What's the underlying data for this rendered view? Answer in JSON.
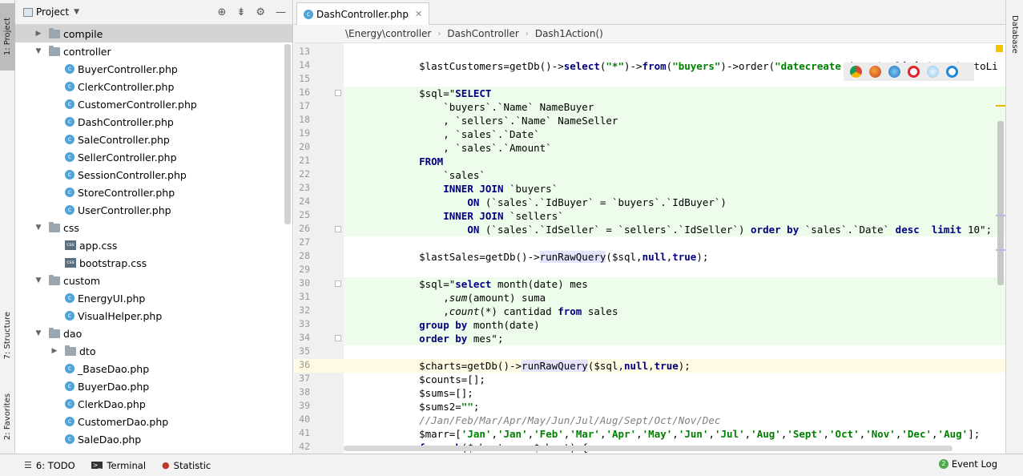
{
  "left_strip": {
    "project_tab": "1: Project",
    "structure_tab": "7: Structure",
    "favorites_tab": "2: Favorites"
  },
  "project_panel": {
    "title": "Project",
    "tree": [
      {
        "label": "compile",
        "type": "folder",
        "depth": 1,
        "expanded": false,
        "selected": true
      },
      {
        "label": "controller",
        "type": "folder",
        "depth": 1,
        "expanded": true
      },
      {
        "label": "BuyerController.php",
        "type": "php",
        "depth": 2
      },
      {
        "label": "ClerkController.php",
        "type": "php",
        "depth": 2
      },
      {
        "label": "CustomerController.php",
        "type": "php",
        "depth": 2
      },
      {
        "label": "DashController.php",
        "type": "php",
        "depth": 2
      },
      {
        "label": "SaleController.php",
        "type": "php",
        "depth": 2
      },
      {
        "label": "SellerController.php",
        "type": "php",
        "depth": 2
      },
      {
        "label": "SessionController.php",
        "type": "php",
        "depth": 2
      },
      {
        "label": "StoreController.php",
        "type": "php",
        "depth": 2
      },
      {
        "label": "UserController.php",
        "type": "php",
        "depth": 2
      },
      {
        "label": "css",
        "type": "folder",
        "depth": 1,
        "expanded": true
      },
      {
        "label": "app.css",
        "type": "css",
        "depth": 2
      },
      {
        "label": "bootstrap.css",
        "type": "css",
        "depth": 2
      },
      {
        "label": "custom",
        "type": "folder",
        "depth": 1,
        "expanded": true
      },
      {
        "label": "EnergyUI.php",
        "type": "php",
        "depth": 2
      },
      {
        "label": "VisualHelper.php",
        "type": "php",
        "depth": 2
      },
      {
        "label": "dao",
        "type": "folder",
        "depth": 1,
        "expanded": true
      },
      {
        "label": "dto",
        "type": "folder",
        "depth": 2,
        "expanded": false
      },
      {
        "label": "_BaseDao.php",
        "type": "php",
        "depth": 2
      },
      {
        "label": "BuyerDao.php",
        "type": "php",
        "depth": 2
      },
      {
        "label": "ClerkDao.php",
        "type": "php",
        "depth": 2
      },
      {
        "label": "CustomerDao.php",
        "type": "php",
        "depth": 2
      },
      {
        "label": "SaleDao.php",
        "type": "php",
        "depth": 2
      }
    ]
  },
  "editor": {
    "tab_label": "DashController.php",
    "breadcrumb": [
      "\\Energy\\controller",
      "DashController",
      "Dash1Action()"
    ],
    "lines": [
      {
        "n": "13",
        "t": ""
      },
      {
        "n": "14",
        "t": "    $lastCustomers=getDb()->select(\"*\")->from(\"buyers\")->order(\"datecreate desc\")->limit(\"10\")->toLi"
      },
      {
        "n": "15",
        "t": ""
      },
      {
        "n": "16",
        "t": "    $sql=\"SELECT"
      },
      {
        "n": "17",
        "t": "        `buyers`.`Name` NameBuyer"
      },
      {
        "n": "18",
        "t": "        , `sellers`.`Name` NameSeller"
      },
      {
        "n": "19",
        "t": "        , `sales`.`Date`"
      },
      {
        "n": "20",
        "t": "        , `sales`.`Amount`"
      },
      {
        "n": "21",
        "t": "    FROM"
      },
      {
        "n": "22",
        "t": "        `sales`"
      },
      {
        "n": "23",
        "t": "        INNER JOIN `buyers`"
      },
      {
        "n": "24",
        "t": "            ON (`sales`.`IdBuyer` = `buyers`.`IdBuyer`)"
      },
      {
        "n": "25",
        "t": "        INNER JOIN `sellers`"
      },
      {
        "n": "26",
        "t": "            ON (`sales`.`IdSeller` = `sellers`.`IdSeller`) order by `sales`.`Date` desc  limit 10\";"
      },
      {
        "n": "27",
        "t": ""
      },
      {
        "n": "28",
        "t": "    $lastSales=getDb()->runRawQuery($sql,null,true);"
      },
      {
        "n": "29",
        "t": ""
      },
      {
        "n": "30",
        "t": "    $sql=\"select month(date) mes"
      },
      {
        "n": "31",
        "t": "        ,sum(amount) suma"
      },
      {
        "n": "32",
        "t": "        ,count(*) cantidad from sales"
      },
      {
        "n": "33",
        "t": "    group by month(date)"
      },
      {
        "n": "34",
        "t": "    order by mes\";"
      },
      {
        "n": "35",
        "t": ""
      },
      {
        "n": "36",
        "t": "    $charts=getDb()->runRawQuery($sql,null,true);"
      },
      {
        "n": "37",
        "t": "    $counts=[];"
      },
      {
        "n": "38",
        "t": "    $sums=[];"
      },
      {
        "n": "39",
        "t": "    $sums2=\"\";"
      },
      {
        "n": "40",
        "t": "    //Jan/Feb/Mar/Apr/May/Jun/Jul/Aug/Sept/Oct/Nov/Dec"
      },
      {
        "n": "41",
        "t": "    $marr=['Jan','Jan','Feb','Mar','Apr','May','Jun','Jul','Aug','Sept','Oct','Nov','Dec','Aug'];"
      },
      {
        "n": "42",
        "t": "    foreach($charts as $chart) {"
      }
    ]
  },
  "right_strip": {
    "database_tab": "Database"
  },
  "bottom_bar": {
    "todo": "6: TODO",
    "terminal": "Terminal",
    "statistic": "Statistic",
    "event_log": "Event Log",
    "event_count": "2"
  },
  "colors": {
    "added_line_bg": "#edfceb",
    "current_line_bg": "#fffae3",
    "keyword": "#000080",
    "string": "#008000"
  }
}
